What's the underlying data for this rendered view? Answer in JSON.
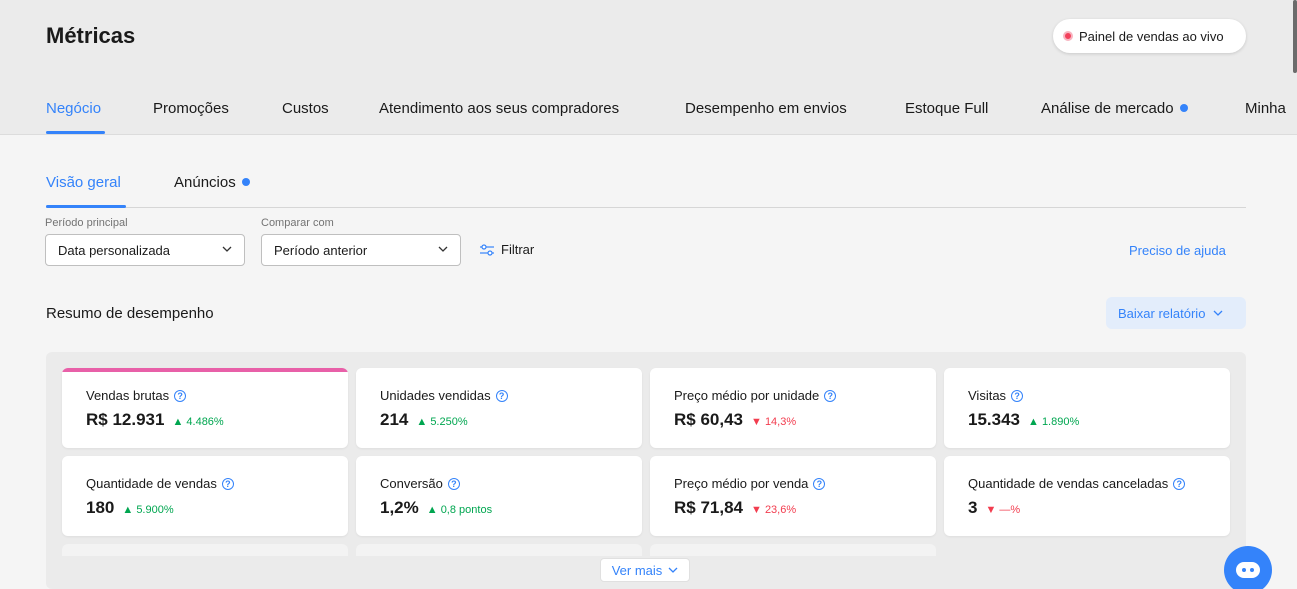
{
  "header": {
    "title": "Métricas",
    "live_button": "Painel de vendas ao vivo"
  },
  "main_tabs": [
    {
      "label": "Negócio",
      "active": true
    },
    {
      "label": "Promoções"
    },
    {
      "label": "Custos"
    },
    {
      "label": "Atendimento aos seus compradores"
    },
    {
      "label": "Desempenho em envios"
    },
    {
      "label": "Estoque Full"
    },
    {
      "label": "Análise de mercado",
      "new_dot": true
    },
    {
      "label": "Minha"
    }
  ],
  "sub_tabs": [
    {
      "label": "Visão geral",
      "active": true
    },
    {
      "label": "Anúncios",
      "new_dot": true
    }
  ],
  "filters": {
    "period_label": "Período principal",
    "period_value": "Data personalizada",
    "compare_label": "Comparar com",
    "compare_value": "Período anterior",
    "filter_button": "Filtrar",
    "help_link": "Preciso de ajuda"
  },
  "summary": {
    "title": "Resumo de desempenho",
    "download_button": "Baixar relatório",
    "more_button": "Ver mais",
    "cards": [
      {
        "label": "Vendas brutas",
        "value": "R$ 12.931",
        "delta": "▲ 4.486%",
        "trend": "up"
      },
      {
        "label": "Unidades vendidas",
        "value": "214",
        "delta": "▲ 5.250%",
        "trend": "up"
      },
      {
        "label": "Preço médio por unidade",
        "value": "R$ 60,43",
        "delta": "▼ 14,3%",
        "trend": "down"
      },
      {
        "label": "Visitas",
        "value": "15.343",
        "delta": "▲ 1.890%",
        "trend": "up"
      },
      {
        "label": "Quantidade de vendas",
        "value": "180",
        "delta": "▲ 5.900%",
        "trend": "up"
      },
      {
        "label": "Conversão",
        "value": "1,2%",
        "delta": "▲ 0,8 pontos",
        "trend": "up"
      },
      {
        "label": "Preço médio por venda",
        "value": "R$ 71,84",
        "delta": "▼ 23,6%",
        "trend": "down"
      },
      {
        "label": "Quantidade de vendas canceladas",
        "value": "3",
        "delta": "▼ —%",
        "trend": "down"
      }
    ]
  },
  "colors": {
    "accent": "#3483fa",
    "up": "#00a650",
    "down": "#f23d4f",
    "highlight": "#e860a8"
  }
}
